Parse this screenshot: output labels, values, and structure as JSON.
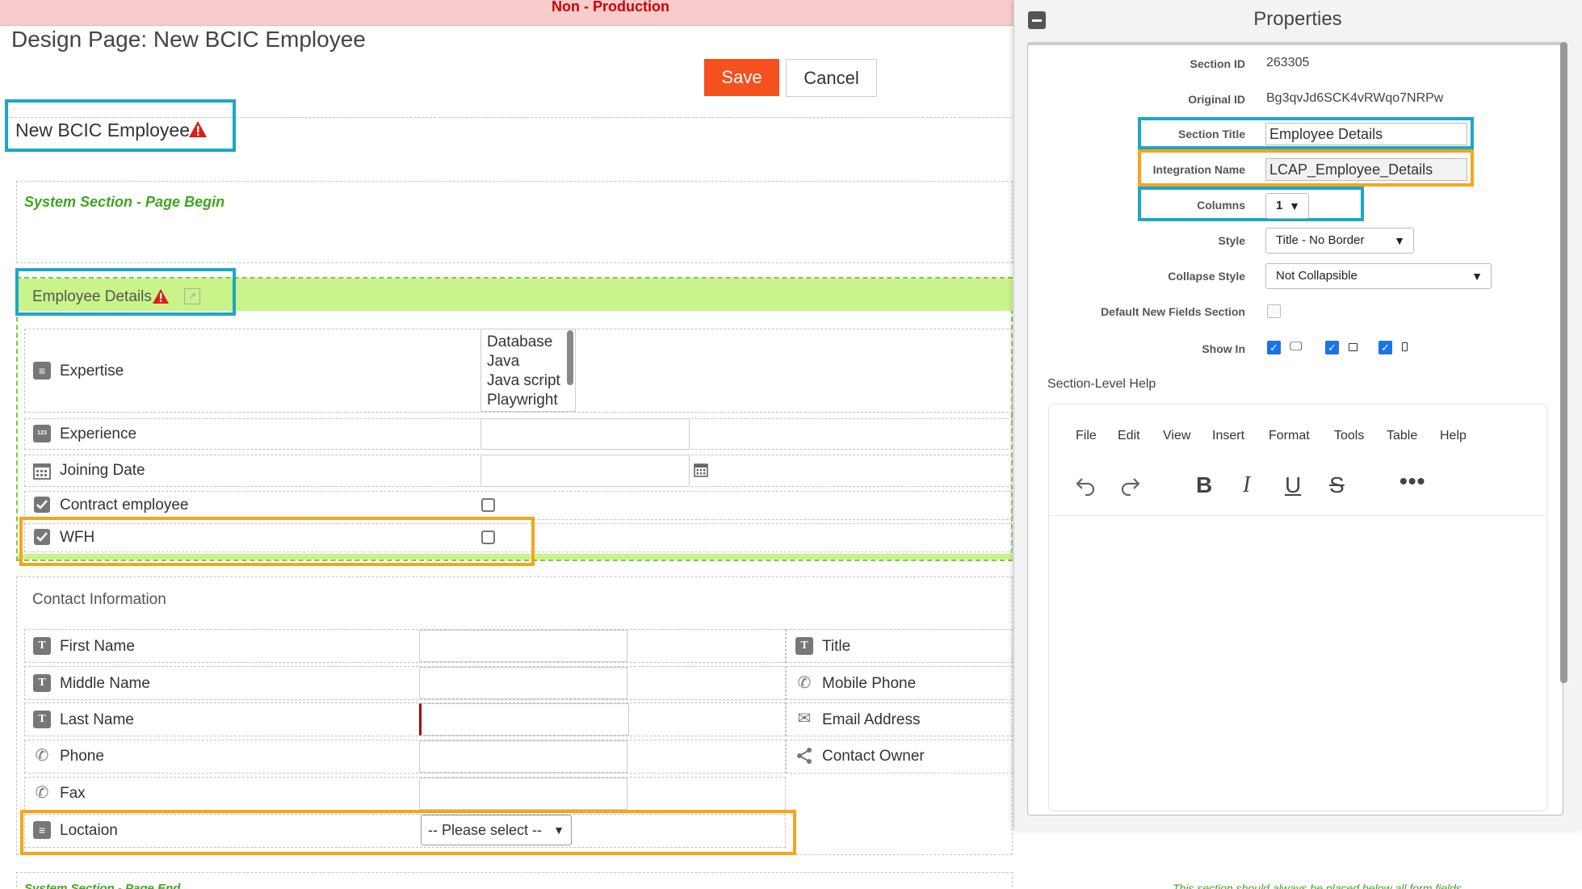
{
  "env_banner": "Non - Production",
  "page_title": "Design Page: New BCIC Employee",
  "buttons": {
    "save": "Save",
    "cancel": "Cancel"
  },
  "form": {
    "name": "New BCIC Employee",
    "system_begin": "System Section - Page Begin",
    "employee_section": {
      "title": "Employee Details",
      "fields": {
        "expertise": {
          "label": "Expertise",
          "icon": "list-icon",
          "options": [
            "Database",
            "Java",
            "Java script",
            "Playwright"
          ]
        },
        "experience": {
          "label": "Experience",
          "icon": "number-icon",
          "icon_text": "123"
        },
        "joining_date": {
          "label": "Joining Date",
          "icon": "calendar-icon"
        },
        "contract": {
          "label": "Contract employee",
          "icon": "checkbox-icon"
        },
        "wfh": {
          "label": "WFH",
          "icon": "checkbox-icon"
        }
      }
    },
    "contact_section": {
      "title": "Contact Information",
      "text_icon": "T",
      "left": {
        "first_name": "First Name",
        "middle_name": "Middle Name",
        "last_name": "Last Name",
        "phone": "Phone",
        "fax": "Fax",
        "location": "Loctaion",
        "location_select": "-- Please select --"
      },
      "right": {
        "title": "Title",
        "mobile": "Mobile Phone",
        "email": "Email Address",
        "owner": "Contact Owner"
      }
    },
    "footer_left": "System Section - Page End",
    "footer_right": "This section should always be placed below all form fields"
  },
  "properties": {
    "title": "Properties",
    "section_id_label": "Section ID",
    "section_id": "263305",
    "original_id_label": "Original ID",
    "original_id": "Bg3qvJd6SCK4vRWqo7NRPw",
    "section_title_label": "Section Title",
    "section_title": "Employee Details",
    "integration_name_label": "Integration Name",
    "integration_name": "LCAP_Employee_Details",
    "columns_label": "Columns",
    "columns": "1",
    "style_label": "Style",
    "style": "Title - No Border",
    "collapse_label": "Collapse Style",
    "collapse": "Not Collapsible",
    "default_new_label": "Default New Fields Section",
    "show_in_label": "Show In",
    "show_in": [
      "desktop",
      "tablet",
      "mobile"
    ],
    "help_label": "Section-Level Help",
    "editor_menu": [
      "File",
      "Edit",
      "View",
      "Insert",
      "Format",
      "Tools",
      "Table",
      "Help"
    ]
  },
  "colors": {
    "save": "#f4511e",
    "highlight_blue": "#1aa7c8",
    "highlight_orange": "#f6a51a",
    "section_green": "#c8f48a",
    "system_green": "#3fa51f",
    "env_banner_bg": "#f8cccc",
    "warning": "#e01b1b"
  }
}
